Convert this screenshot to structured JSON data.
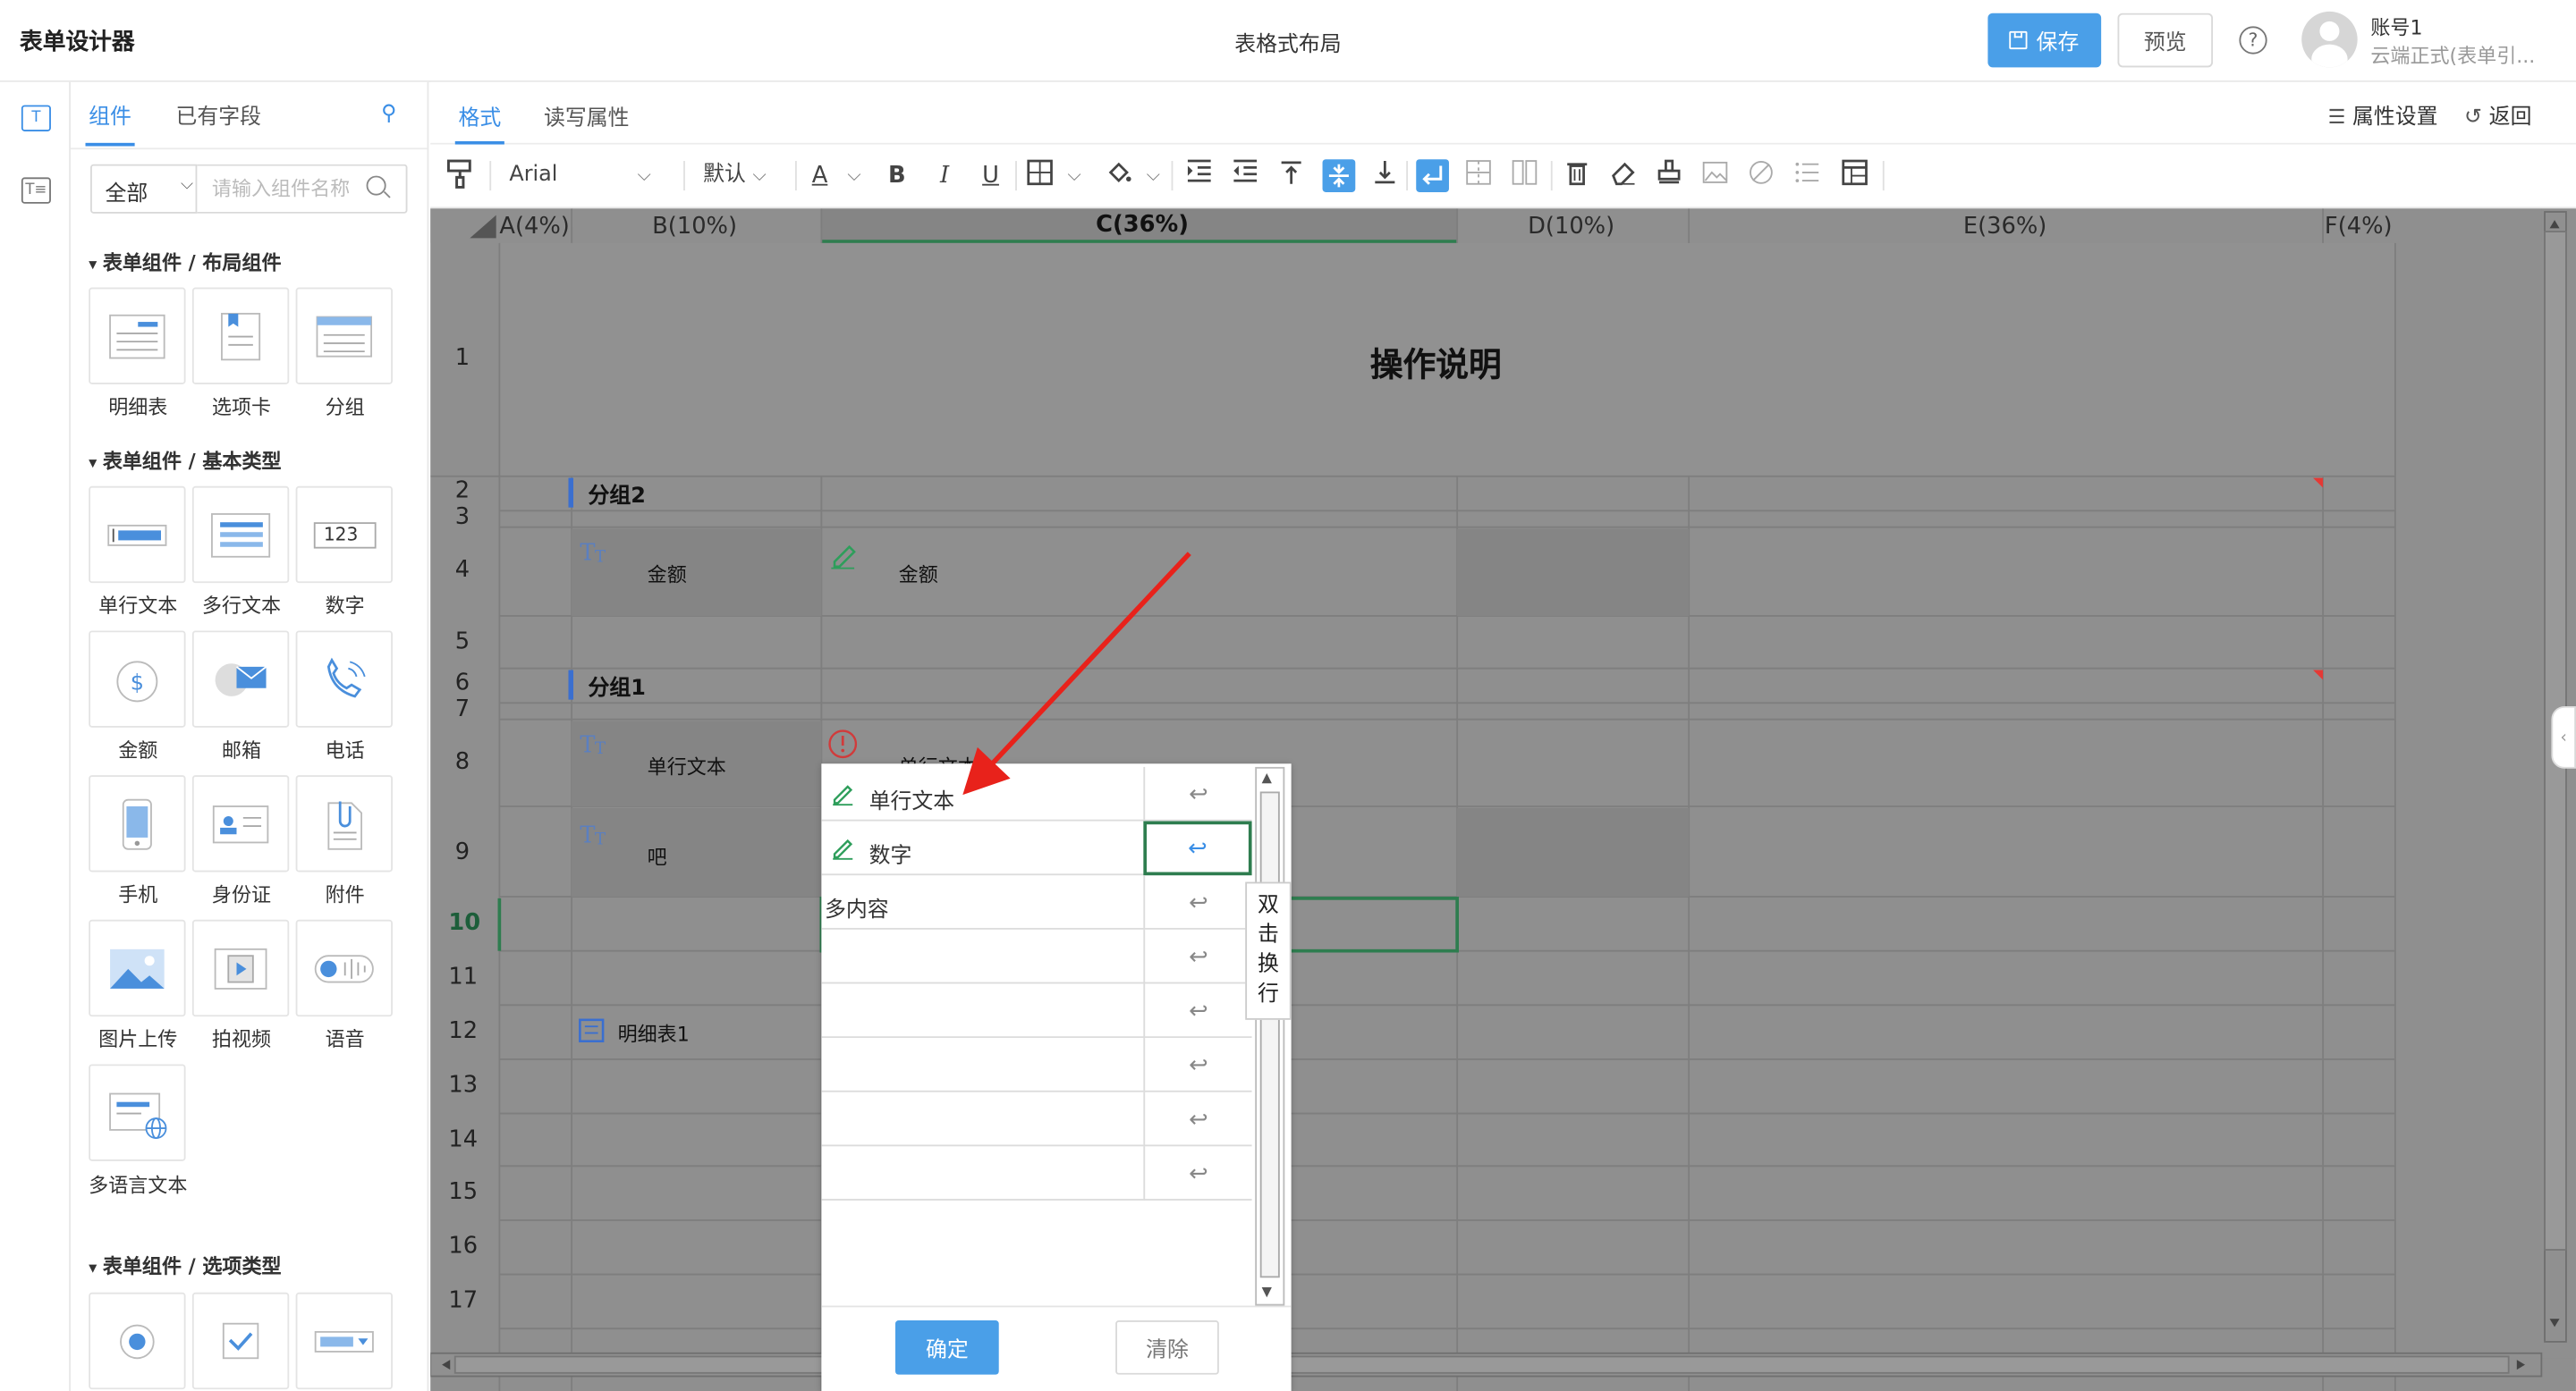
{
  "header": {
    "app_title": "表单设计器",
    "layout_title": "表格式布局",
    "save_label": "保存",
    "preview_label": "预览",
    "help_symbol": "?",
    "account_name": "账号1",
    "account_org": "云端正式(表单引..."
  },
  "panel": {
    "tab_components": "组件",
    "tab_fields": "已有字段",
    "filter_value": "全部",
    "search_placeholder": "请输入组件名称",
    "sections": [
      {
        "title": "表单组件 / 布局组件",
        "items": [
          "明细表",
          "选项卡",
          "分组"
        ]
      },
      {
        "title": "表单组件 / 基本类型",
        "items": [
          "单行文本",
          "多行文本",
          "数字",
          "金额",
          "邮箱",
          "电话",
          "手机",
          "身份证",
          "附件",
          "图片上传",
          "拍视频",
          "语音",
          "多语言文本"
        ]
      },
      {
        "title": "表单组件 / 选项类型",
        "items": []
      }
    ],
    "number_tile_text": "123"
  },
  "format": {
    "tab_format": "格式",
    "tab_readwrite": "读写属性",
    "prop_settings": "属性设置",
    "back": "返回"
  },
  "toolbar": {
    "font_family": "Arial",
    "font_size": "默认",
    "font_color_glyph": "A",
    "bold_glyph": "B",
    "italic_glyph": "I",
    "underline_glyph": "U"
  },
  "grid": {
    "columns": [
      "A(4%)",
      "B(10%)",
      "C(36%)",
      "D(10%)",
      "E(36%)",
      "F(4%)"
    ],
    "active_column": "C(36%)",
    "rows": [
      "1",
      "2",
      "3",
      "4",
      "5",
      "6",
      "7",
      "8",
      "9",
      "10",
      "11",
      "12",
      "13",
      "14",
      "15",
      "16",
      "17"
    ],
    "active_row": "10",
    "title_cell": "操作说明",
    "group2": "分组2",
    "group1": "分组1",
    "row4_label": "金额",
    "row4_value": "金额",
    "row8_label": "单行文本",
    "row8_value_partial": "单行文本",
    "row9_label": "吧",
    "row12_label": "明细表1"
  },
  "dialog": {
    "options": [
      {
        "text": "单行文本",
        "icon": true
      },
      {
        "text": "数字",
        "icon": true
      },
      {
        "text": "多内容",
        "icon": false
      },
      {
        "text": "",
        "icon": false
      },
      {
        "text": "",
        "icon": false
      },
      {
        "text": "",
        "icon": false
      },
      {
        "text": "",
        "icon": false
      },
      {
        "text": "",
        "icon": false
      }
    ],
    "wrap_glyph": "↩",
    "tooltip_chars": [
      "双",
      "击",
      "换",
      "行"
    ],
    "ok_label": "确定",
    "clear_label": "清除"
  },
  "colors": {
    "primary": "#4a9fe8",
    "link": "#3a8ee6",
    "grid_bg": "#8f8f8f",
    "selection": "#2e7d4f",
    "annotation_arrow": "#e8221b"
  }
}
